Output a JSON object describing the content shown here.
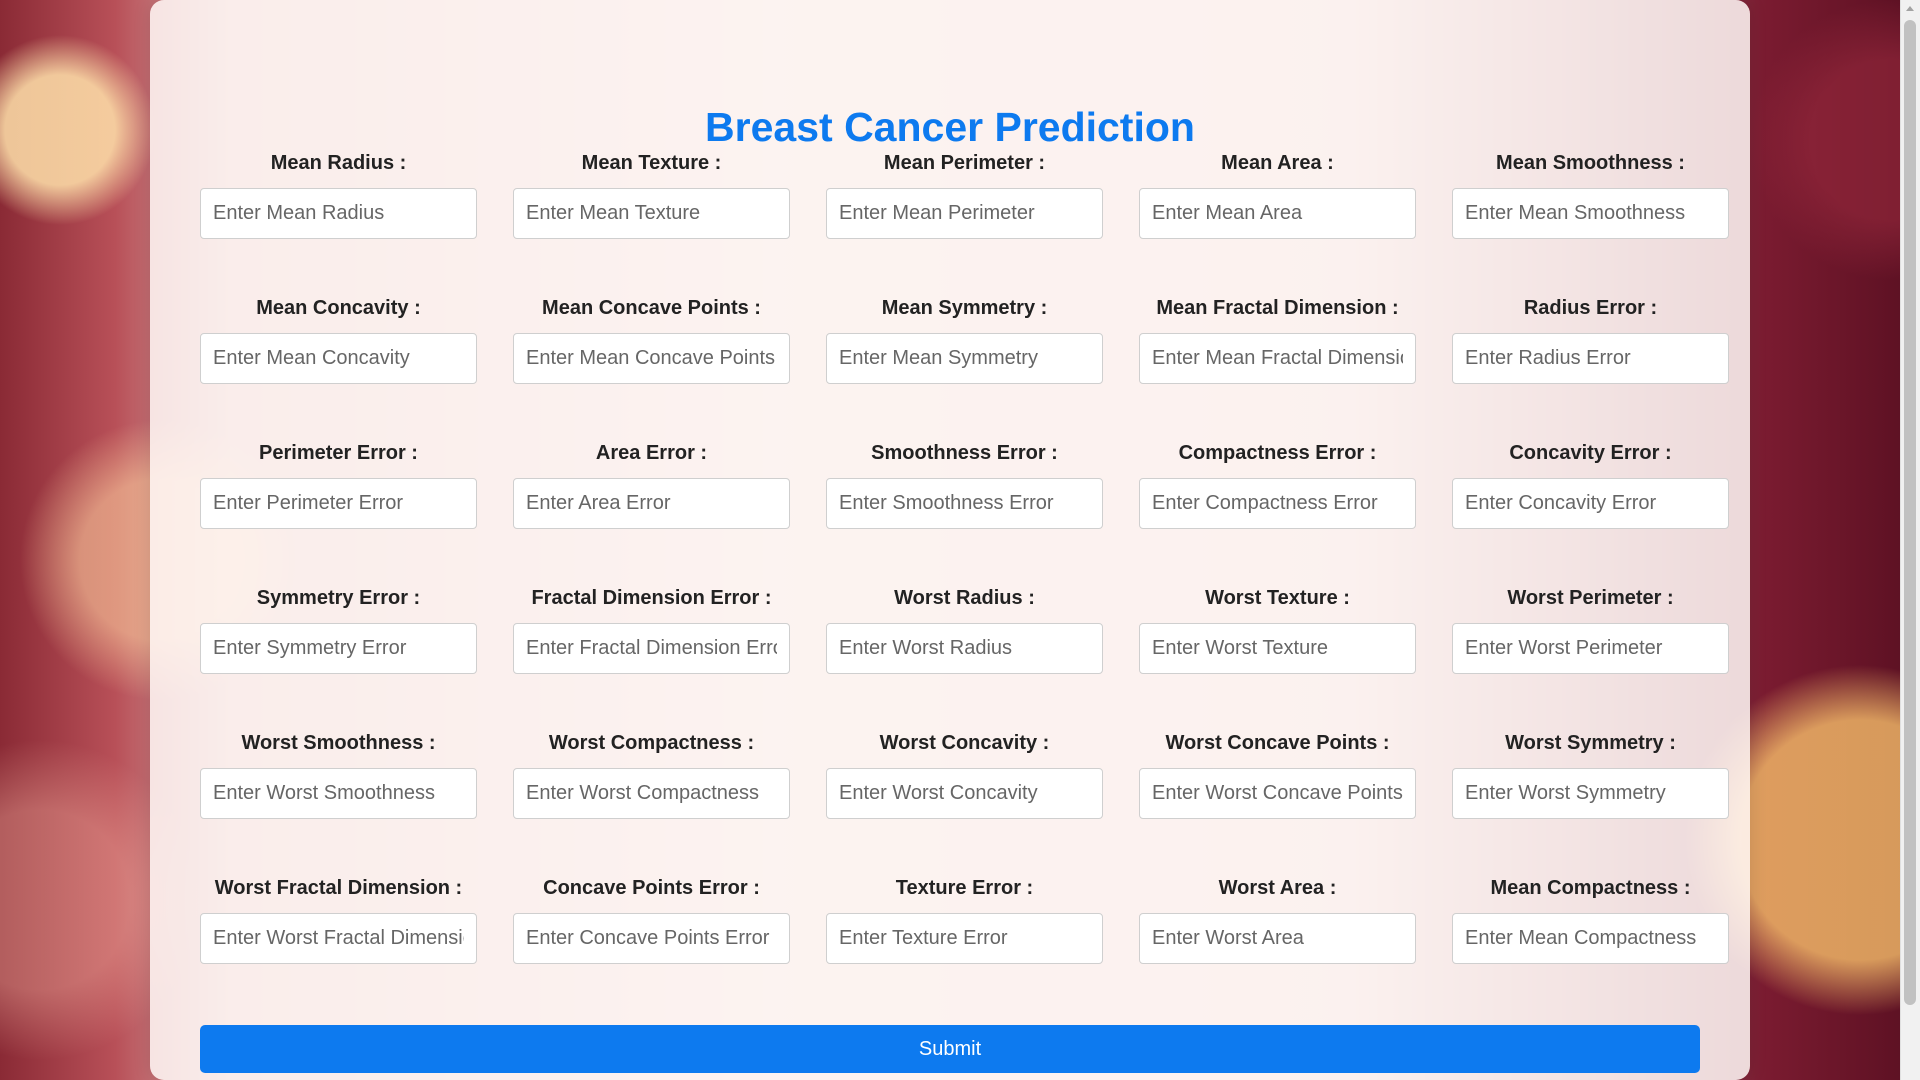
{
  "page": {
    "title": "Breast Cancer Prediction",
    "submit_label": "Submit"
  },
  "colors": {
    "accent": "#0d7aef",
    "label_text": "#222222",
    "input_border": "#cfcfcf"
  },
  "fields": [
    {
      "label": "Mean Radius :",
      "placeholder": "Enter Mean Radius",
      "value": ""
    },
    {
      "label": "Mean Texture :",
      "placeholder": "Enter Mean Texture",
      "value": ""
    },
    {
      "label": "Mean Perimeter :",
      "placeholder": "Enter Mean Perimeter",
      "value": ""
    },
    {
      "label": "Mean Area :",
      "placeholder": "Enter Mean Area",
      "value": ""
    },
    {
      "label": "Mean Smoothness :",
      "placeholder": "Enter Mean Smoothness",
      "value": ""
    },
    {
      "label": "Mean Concavity :",
      "placeholder": "Enter Mean Concavity",
      "value": ""
    },
    {
      "label": "Mean Concave Points :",
      "placeholder": "Enter Mean Concave Points",
      "value": ""
    },
    {
      "label": "Mean Symmetry :",
      "placeholder": "Enter Mean Symmetry",
      "value": ""
    },
    {
      "label": "Mean Fractal Dimension :",
      "placeholder": "Enter Mean Fractal Dimension",
      "value": ""
    },
    {
      "label": "Radius Error :",
      "placeholder": "Enter Radius Error",
      "value": ""
    },
    {
      "label": "Perimeter Error :",
      "placeholder": "Enter Perimeter Error",
      "value": ""
    },
    {
      "label": "Area Error :",
      "placeholder": "Enter Area Error",
      "value": ""
    },
    {
      "label": "Smoothness Error :",
      "placeholder": "Enter Smoothness Error",
      "value": ""
    },
    {
      "label": "Compactness Error :",
      "placeholder": "Enter Compactness Error",
      "value": ""
    },
    {
      "label": "Concavity Error :",
      "placeholder": "Enter Concavity Error",
      "value": ""
    },
    {
      "label": "Symmetry Error :",
      "placeholder": "Enter Symmetry Error",
      "value": ""
    },
    {
      "label": "Fractal Dimension Error :",
      "placeholder": "Enter Fractal Dimension Error",
      "value": ""
    },
    {
      "label": "Worst Radius :",
      "placeholder": "Enter Worst Radius",
      "value": ""
    },
    {
      "label": "Worst Texture :",
      "placeholder": "Enter Worst Texture",
      "value": ""
    },
    {
      "label": "Worst Perimeter :",
      "placeholder": "Enter Worst Perimeter",
      "value": ""
    },
    {
      "label": "Worst Smoothness :",
      "placeholder": "Enter Worst Smoothness",
      "value": ""
    },
    {
      "label": "Worst Compactness :",
      "placeholder": "Enter Worst Compactness",
      "value": ""
    },
    {
      "label": "Worst Concavity :",
      "placeholder": "Enter Worst Concavity",
      "value": ""
    },
    {
      "label": "Worst Concave Points :",
      "placeholder": "Enter Worst Concave Points",
      "value": ""
    },
    {
      "label": "Worst Symmetry :",
      "placeholder": "Enter Worst Symmetry",
      "value": ""
    },
    {
      "label": "Worst Fractal Dimension :",
      "placeholder": "Enter Worst Fractal Dimension",
      "value": ""
    },
    {
      "label": "Concave Points Error :",
      "placeholder": "Enter Concave Points Error",
      "value": ""
    },
    {
      "label": "Texture Error :",
      "placeholder": "Enter Texture Error",
      "value": ""
    },
    {
      "label": "Worst Area :",
      "placeholder": "Enter Worst Area",
      "value": ""
    },
    {
      "label": "Mean Compactness :",
      "placeholder": "Enter Mean Compactness",
      "value": ""
    }
  ]
}
